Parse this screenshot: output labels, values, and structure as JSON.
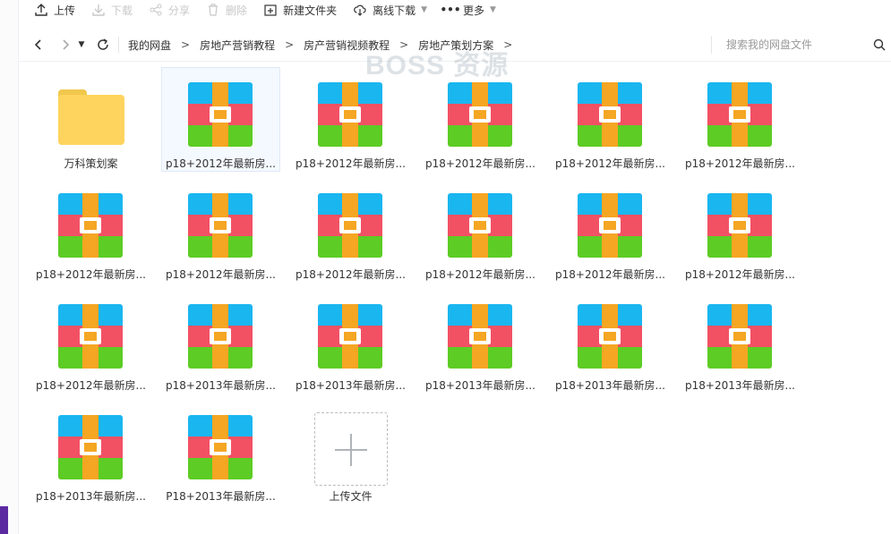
{
  "toolbar": {
    "upload": "上传",
    "download": "下载",
    "share": "分享",
    "delete": "删除",
    "new_folder": "新建文件夹",
    "offline_download": "离线下载",
    "more": "更多"
  },
  "breadcrumb": [
    "我的网盘",
    "房地产营销教程",
    "房产营销视频教程",
    "房地产策划方案"
  ],
  "search": {
    "placeholder": "搜索我的网盘文件"
  },
  "watermark": "BOSS 资源",
  "files": [
    {
      "name": "万科策划案",
      "type": "folder"
    },
    {
      "name": "p18+2012年最新房...",
      "type": "archive",
      "selected": true
    },
    {
      "name": "p18+2012年最新房...",
      "type": "archive"
    },
    {
      "name": "p18+2012年最新房...",
      "type": "archive"
    },
    {
      "name": "p18+2012年最新房...",
      "type": "archive"
    },
    {
      "name": "p18+2012年最新房...",
      "type": "archive"
    },
    {
      "name": "p18+2012年最新房...",
      "type": "archive"
    },
    {
      "name": "p18+2012年最新房...",
      "type": "archive"
    },
    {
      "name": "p18+2012年最新房...",
      "type": "archive"
    },
    {
      "name": "p18+2012年最新房...",
      "type": "archive"
    },
    {
      "name": "p18+2012年最新房...",
      "type": "archive"
    },
    {
      "name": "p18+2012年最新房...",
      "type": "archive"
    },
    {
      "name": "p18+2012年最新房...",
      "type": "archive"
    },
    {
      "name": "p18+2013年最新房...",
      "type": "archive"
    },
    {
      "name": "p18+2013年最新房...",
      "type": "archive"
    },
    {
      "name": "p18+2013年最新房...",
      "type": "archive"
    },
    {
      "name": "p18+2013年最新房...",
      "type": "archive"
    },
    {
      "name": "p18+2013年最新房...",
      "type": "archive"
    },
    {
      "name": "p18+2013年最新房...",
      "type": "archive"
    },
    {
      "name": "P18+2013年最新房...",
      "type": "archive"
    },
    {
      "name": "上传文件",
      "type": "upload"
    }
  ]
}
